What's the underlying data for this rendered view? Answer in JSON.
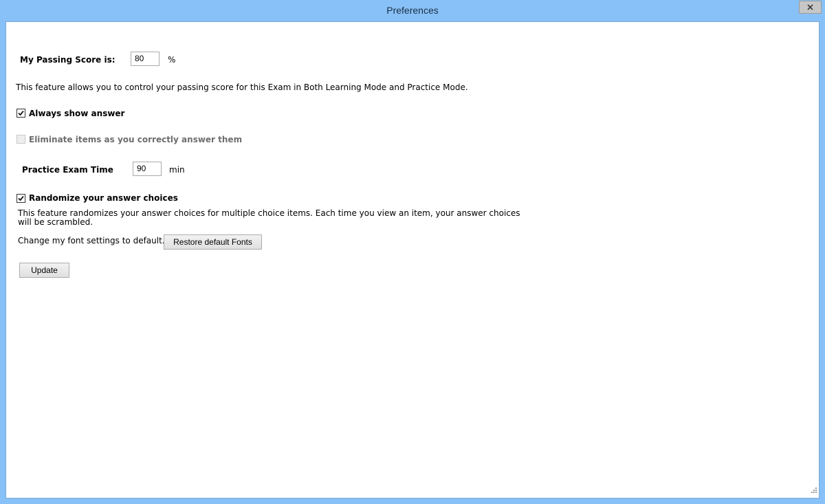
{
  "window": {
    "title": "Preferences",
    "close_icon": "close-icon"
  },
  "passing_score": {
    "label": "My Passing Score is:",
    "value": "80",
    "unit": "%",
    "description": "This feature allows you to control your passing score for this Exam in Both Learning Mode and Practice Mode."
  },
  "always_show_answer": {
    "label": "Always show answer",
    "checked": true
  },
  "eliminate_items": {
    "label": "Eliminate items as you correctly answer them",
    "checked": false,
    "enabled": false
  },
  "practice_exam_time": {
    "label": "Practice Exam Time",
    "value": "90",
    "unit": "min"
  },
  "randomize": {
    "label": "Randomize your answer choices",
    "checked": true,
    "description_line1": "This feature randomizes your answer choices for multiple choice items. Each time you view an item, your answer choices",
    "description_line2": "will be scrambled."
  },
  "fonts": {
    "label": "Change my font settings to default.",
    "button_label": "Restore default Fonts"
  },
  "update_button_label": "Update"
}
